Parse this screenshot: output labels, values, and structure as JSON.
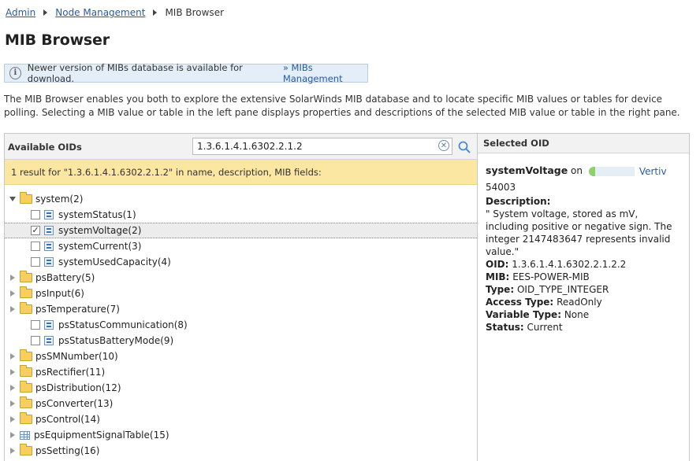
{
  "breadcrumb": {
    "items": [
      "Admin",
      "Node Management"
    ],
    "current": "MIB Browser"
  },
  "page_title": "MIB Browser",
  "info_bar": {
    "message": "Newer version of MIBs database is available for download.",
    "link": "» MIBs Management"
  },
  "intro": "The MIB Browser enables you both to explore the extensive SolarWinds MIB database and to locate specific MIB values or tables for device polling. Selecting a MIB value or table in the left pane displays properties and descriptions of the selected MIB value or table in the right pane.",
  "left_panel": {
    "title": "Available OIDs",
    "search_value": "1.3.6.1.4.1.6302.2.1.2",
    "result_text": "1 result for \"1.3.6.1.4.1.6302.2.1.2\" in name, description, MIB fields:"
  },
  "tree": [
    {
      "label": "system(2)",
      "kind": "folder",
      "expanded": true,
      "level": 0
    },
    {
      "label": "systemStatus(1)",
      "kind": "leaf",
      "checked": false,
      "level": 1
    },
    {
      "label": "systemVoltage(2)",
      "kind": "leaf",
      "checked": true,
      "selected": true,
      "level": 1
    },
    {
      "label": "systemCurrent(3)",
      "kind": "leaf",
      "checked": false,
      "level": 1
    },
    {
      "label": "systemUsedCapacity(4)",
      "kind": "leaf",
      "checked": false,
      "level": 1
    },
    {
      "label": "psBattery(5)",
      "kind": "folder",
      "expanded": false,
      "level": 0
    },
    {
      "label": "psInput(6)",
      "kind": "folder",
      "expanded": false,
      "level": 0
    },
    {
      "label": "psTemperature(7)",
      "kind": "folder",
      "expanded": false,
      "level": 0
    },
    {
      "label": "psStatusCommunication(8)",
      "kind": "leaf",
      "checked": false,
      "level": 1
    },
    {
      "label": "psStatusBatteryMode(9)",
      "kind": "leaf",
      "checked": false,
      "level": 1
    },
    {
      "label": "psSMNumber(10)",
      "kind": "folder",
      "expanded": false,
      "level": 0
    },
    {
      "label": "psRectifier(11)",
      "kind": "folder",
      "expanded": false,
      "level": 0
    },
    {
      "label": "psDistribution(12)",
      "kind": "folder",
      "expanded": false,
      "level": 0
    },
    {
      "label": "psConverter(13)",
      "kind": "folder",
      "expanded": false,
      "level": 0
    },
    {
      "label": "psControl(14)",
      "kind": "folder",
      "expanded": false,
      "level": 0
    },
    {
      "label": "psEquipmentSignalTable(15)",
      "kind": "table",
      "expanded": false,
      "level": 0
    },
    {
      "label": "psSetting(16)",
      "kind": "folder",
      "expanded": false,
      "level": 0
    }
  ],
  "right_panel": {
    "title": "Selected OID",
    "name": "systemVoltage",
    "on_text": "on",
    "node_vendor": "Vertiv",
    "node_id": "54003",
    "description_label": "Description:",
    "description": "\" System voltage, stored as mV, including positive or negative sign. The integer 2147483647 represents invalid value.\"",
    "oid_label": "OID:",
    "oid": "1.3.6.1.4.1.6302.2.1.2.2",
    "mib_label": "MIB:",
    "mib": "EES-POWER-MIB",
    "type_label": "Type:",
    "type": "OID_TYPE_INTEGER",
    "access_label": "Access Type:",
    "access": "ReadOnly",
    "variable_label": "Variable Type:",
    "variable": "None",
    "status_label": "Status:",
    "status": "Current"
  },
  "colors": {
    "link": "#2a5b9e",
    "result_bar": "#fbe6a2",
    "info_bar": "#e3eef8",
    "folder": "#f6cf5e"
  }
}
